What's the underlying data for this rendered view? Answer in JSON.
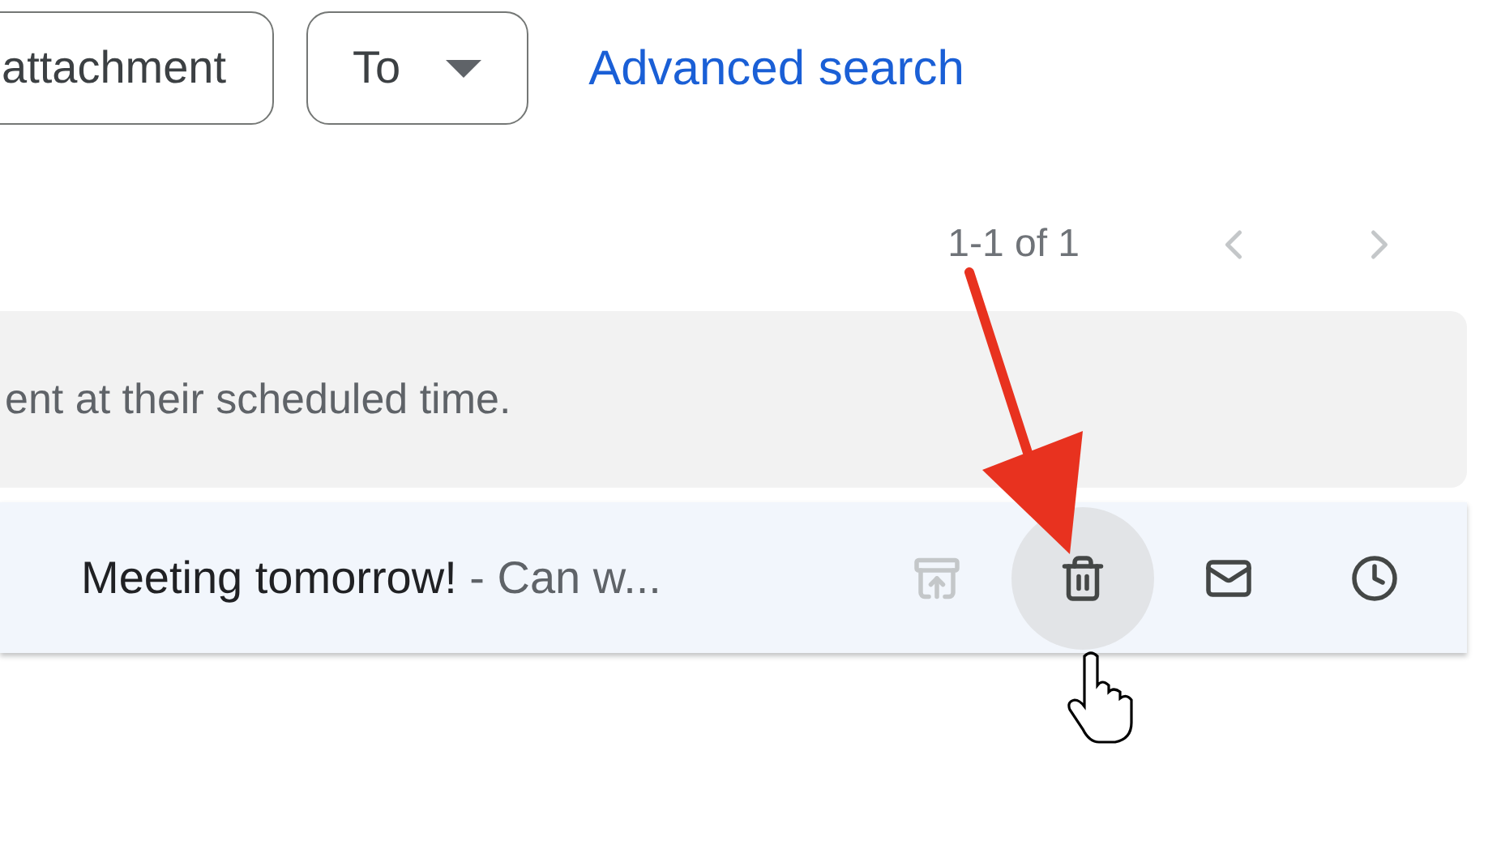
{
  "filter_chips": [
    {
      "label": "attachment",
      "kind": "plain"
    },
    {
      "label": "To",
      "kind": "dropdown"
    }
  ],
  "advanced_search": "Advanced search",
  "pagination": {
    "range": "1-1 of 1",
    "prev_disabled": true,
    "next_disabled": true
  },
  "notice": "ent at their scheduled time.",
  "emails": [
    {
      "subject": "Meeting tomorrow!",
      "snippet": "- Can w...",
      "actions": [
        {
          "kind": "archive",
          "disabled": true,
          "hovered": false
        },
        {
          "kind": "delete",
          "disabled": false,
          "hovered": true
        },
        {
          "kind": "mark-unread",
          "disabled": false,
          "hovered": false
        },
        {
          "kind": "snooze",
          "disabled": false,
          "hovered": false
        }
      ]
    }
  ]
}
